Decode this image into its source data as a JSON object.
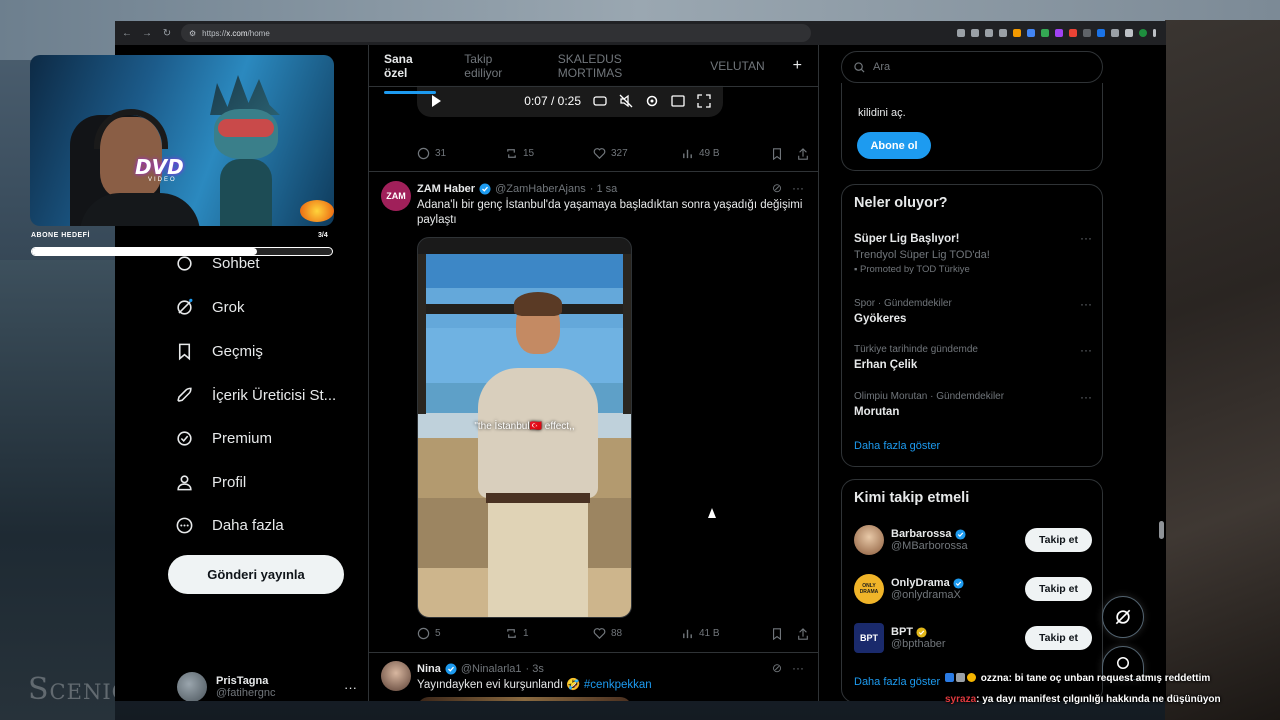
{
  "browser": {
    "url_prefix": "https://",
    "url_host": "x.com",
    "url_path": "/home"
  },
  "sidebar": {
    "items": [
      {
        "label": "Sohbet",
        "icon": "chat-icon"
      },
      {
        "label": "Grok",
        "icon": "grok-icon"
      },
      {
        "label": "Geçmiş",
        "icon": "bookmark-icon"
      },
      {
        "label": "İçerik Üreticisi St...",
        "icon": "rocket-icon"
      },
      {
        "label": "Premium",
        "icon": "premium-check-icon"
      },
      {
        "label": "Profil",
        "icon": "profile-icon"
      },
      {
        "label": "Daha fazla",
        "icon": "more-circle-icon"
      }
    ],
    "post_button": "Gönderi yayınla",
    "account": {
      "name": "PrisTagna",
      "handle": "@fatihergnc",
      "more": "···"
    }
  },
  "tabs": [
    "Sana özel",
    "Takip ediliyor",
    "SKALEDUS MORTIMAS",
    "VELUTAN"
  ],
  "tab_add": "+",
  "video": {
    "time": "0:07 / 0:25"
  },
  "tweets": [
    {
      "replies": "31",
      "reposts": "15",
      "likes": "327",
      "views": "49 B"
    },
    {
      "avatar_text": "ZAM",
      "name": "ZAM Haber",
      "handle": "@ZamHaberAjans",
      "time": "· 1 sa",
      "text": "Adana'lı bir genç İstanbul'da yaşamaya başladıktan sonra yaşadığı değişimi paylaştı",
      "media_caption": "\"the İstanbul🇹🇷 effect,,",
      "replies": "5",
      "reposts": "1",
      "likes": "88",
      "views": "41 B"
    },
    {
      "name": "Nina",
      "handle": "@Ninalarla1",
      "time": "· 3s",
      "text": "Yayındayken evi kurşunlandı 🤣",
      "hashtag": "#cenkpekkan"
    }
  ],
  "search": {
    "placeholder": "Ara"
  },
  "subscribe": {
    "text": "kilidini aç.",
    "button": "Abone ol"
  },
  "trends": {
    "title": "Neler oluyor?",
    "items": [
      {
        "name": "Süper Lig Başlıyor!",
        "sub": "Trendyol Süper Lig TOD'da!",
        "promo": "Promoted by TOD Türkiye"
      },
      {
        "meta": "Spor · Gündemdekiler",
        "name": "Gyökeres"
      },
      {
        "meta": "Türkiye tarihinde gündemde",
        "name": "Erhan Çelik"
      },
      {
        "meta": "Olimpiu Morutan · Gündemdekiler",
        "name": "Morutan"
      }
    ],
    "more": "Daha fazla göster",
    "item_menu": "···"
  },
  "who_to_follow": {
    "title": "Kimi takip etmeli",
    "items": [
      {
        "name": "Barbarossa",
        "handle": "@MBarborossa",
        "verified_color": "#1d9bf0",
        "avatar_color": "#c8a27a"
      },
      {
        "name": "OnlyDrama",
        "handle": "@onlydramaX",
        "verified_color": "#1d9bf0",
        "avatar_color": "#f0b429",
        "avatar_text": "ONLY DRAMA"
      },
      {
        "name": "BPT",
        "handle": "@bpthaber",
        "verified_color": "#e2b719",
        "avatar_color": "#1a2a6c",
        "avatar_text": "BPT"
      }
    ],
    "button": "Takip et",
    "more": "Daha fazla göster"
  },
  "stream": {
    "goal_label": "ABONE HEDEFİ",
    "goal_count": "3/4",
    "goal_progress": 0.75,
    "dvd_text": "DVD",
    "dvd_sub": "VIDEO",
    "watermark": "Scenic Relaxation"
  },
  "chat": [
    {
      "user": "ozzna",
      "message": ": bi tane oç unban request atmış reddettim"
    },
    {
      "user": "syraza",
      "message": ": ya dayı manifest çılgınlığı hakkında ne düşünüyon"
    }
  ],
  "colors": {
    "accent": "#1d9bf0",
    "background": "#000000",
    "muted": "#71767b"
  }
}
